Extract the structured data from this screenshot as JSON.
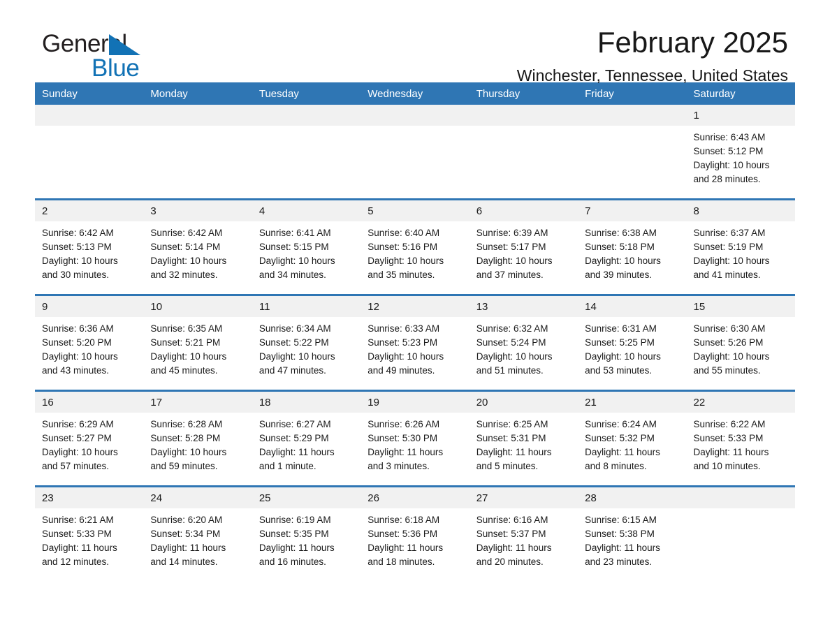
{
  "brand": {
    "word1": "General",
    "word2": "Blue",
    "flag_color": "#1272b5",
    "logo_name": "general-blue-logo"
  },
  "header": {
    "title": "February 2025",
    "subtitle": "Winchester, Tennessee, United States"
  },
  "theme": {
    "header_blue": "#2f76b4",
    "row_divider_blue": "#2f76b4",
    "daynum_band": "#f1f1f1",
    "text": "#1a1a1a"
  },
  "weekday_headers": [
    "Sunday",
    "Monday",
    "Tuesday",
    "Wednesday",
    "Thursday",
    "Friday",
    "Saturday"
  ],
  "labels": {
    "sunrise_prefix": "Sunrise:",
    "sunset_prefix": "Sunset:",
    "daylight_prefix": "Daylight:"
  },
  "weeks": [
    [
      {
        "day": "",
        "blank": true
      },
      {
        "day": "",
        "blank": true
      },
      {
        "day": "",
        "blank": true
      },
      {
        "day": "",
        "blank": true
      },
      {
        "day": "",
        "blank": true
      },
      {
        "day": "",
        "blank": true
      },
      {
        "day": "1",
        "sunrise": "Sunrise: 6:43 AM",
        "sunset": "Sunset: 5:12 PM",
        "daylight1": "Daylight: 10 hours",
        "daylight2": "and 28 minutes."
      }
    ],
    [
      {
        "day": "2",
        "sunrise": "Sunrise: 6:42 AM",
        "sunset": "Sunset: 5:13 PM",
        "daylight1": "Daylight: 10 hours",
        "daylight2": "and 30 minutes."
      },
      {
        "day": "3",
        "sunrise": "Sunrise: 6:42 AM",
        "sunset": "Sunset: 5:14 PM",
        "daylight1": "Daylight: 10 hours",
        "daylight2": "and 32 minutes."
      },
      {
        "day": "4",
        "sunrise": "Sunrise: 6:41 AM",
        "sunset": "Sunset: 5:15 PM",
        "daylight1": "Daylight: 10 hours",
        "daylight2": "and 34 minutes."
      },
      {
        "day": "5",
        "sunrise": "Sunrise: 6:40 AM",
        "sunset": "Sunset: 5:16 PM",
        "daylight1": "Daylight: 10 hours",
        "daylight2": "and 35 minutes."
      },
      {
        "day": "6",
        "sunrise": "Sunrise: 6:39 AM",
        "sunset": "Sunset: 5:17 PM",
        "daylight1": "Daylight: 10 hours",
        "daylight2": "and 37 minutes."
      },
      {
        "day": "7",
        "sunrise": "Sunrise: 6:38 AM",
        "sunset": "Sunset: 5:18 PM",
        "daylight1": "Daylight: 10 hours",
        "daylight2": "and 39 minutes."
      },
      {
        "day": "8",
        "sunrise": "Sunrise: 6:37 AM",
        "sunset": "Sunset: 5:19 PM",
        "daylight1": "Daylight: 10 hours",
        "daylight2": "and 41 minutes."
      }
    ],
    [
      {
        "day": "9",
        "sunrise": "Sunrise: 6:36 AM",
        "sunset": "Sunset: 5:20 PM",
        "daylight1": "Daylight: 10 hours",
        "daylight2": "and 43 minutes."
      },
      {
        "day": "10",
        "sunrise": "Sunrise: 6:35 AM",
        "sunset": "Sunset: 5:21 PM",
        "daylight1": "Daylight: 10 hours",
        "daylight2": "and 45 minutes."
      },
      {
        "day": "11",
        "sunrise": "Sunrise: 6:34 AM",
        "sunset": "Sunset: 5:22 PM",
        "daylight1": "Daylight: 10 hours",
        "daylight2": "and 47 minutes."
      },
      {
        "day": "12",
        "sunrise": "Sunrise: 6:33 AM",
        "sunset": "Sunset: 5:23 PM",
        "daylight1": "Daylight: 10 hours",
        "daylight2": "and 49 minutes."
      },
      {
        "day": "13",
        "sunrise": "Sunrise: 6:32 AM",
        "sunset": "Sunset: 5:24 PM",
        "daylight1": "Daylight: 10 hours",
        "daylight2": "and 51 minutes."
      },
      {
        "day": "14",
        "sunrise": "Sunrise: 6:31 AM",
        "sunset": "Sunset: 5:25 PM",
        "daylight1": "Daylight: 10 hours",
        "daylight2": "and 53 minutes."
      },
      {
        "day": "15",
        "sunrise": "Sunrise: 6:30 AM",
        "sunset": "Sunset: 5:26 PM",
        "daylight1": "Daylight: 10 hours",
        "daylight2": "and 55 minutes."
      }
    ],
    [
      {
        "day": "16",
        "sunrise": "Sunrise: 6:29 AM",
        "sunset": "Sunset: 5:27 PM",
        "daylight1": "Daylight: 10 hours",
        "daylight2": "and 57 minutes."
      },
      {
        "day": "17",
        "sunrise": "Sunrise: 6:28 AM",
        "sunset": "Sunset: 5:28 PM",
        "daylight1": "Daylight: 10 hours",
        "daylight2": "and 59 minutes."
      },
      {
        "day": "18",
        "sunrise": "Sunrise: 6:27 AM",
        "sunset": "Sunset: 5:29 PM",
        "daylight1": "Daylight: 11 hours",
        "daylight2": "and 1 minute."
      },
      {
        "day": "19",
        "sunrise": "Sunrise: 6:26 AM",
        "sunset": "Sunset: 5:30 PM",
        "daylight1": "Daylight: 11 hours",
        "daylight2": "and 3 minutes."
      },
      {
        "day": "20",
        "sunrise": "Sunrise: 6:25 AM",
        "sunset": "Sunset: 5:31 PM",
        "daylight1": "Daylight: 11 hours",
        "daylight2": "and 5 minutes."
      },
      {
        "day": "21",
        "sunrise": "Sunrise: 6:24 AM",
        "sunset": "Sunset: 5:32 PM",
        "daylight1": "Daylight: 11 hours",
        "daylight2": "and 8 minutes."
      },
      {
        "day": "22",
        "sunrise": "Sunrise: 6:22 AM",
        "sunset": "Sunset: 5:33 PM",
        "daylight1": "Daylight: 11 hours",
        "daylight2": "and 10 minutes."
      }
    ],
    [
      {
        "day": "23",
        "sunrise": "Sunrise: 6:21 AM",
        "sunset": "Sunset: 5:33 PM",
        "daylight1": "Daylight: 11 hours",
        "daylight2": "and 12 minutes."
      },
      {
        "day": "24",
        "sunrise": "Sunrise: 6:20 AM",
        "sunset": "Sunset: 5:34 PM",
        "daylight1": "Daylight: 11 hours",
        "daylight2": "and 14 minutes."
      },
      {
        "day": "25",
        "sunrise": "Sunrise: 6:19 AM",
        "sunset": "Sunset: 5:35 PM",
        "daylight1": "Daylight: 11 hours",
        "daylight2": "and 16 minutes."
      },
      {
        "day": "26",
        "sunrise": "Sunrise: 6:18 AM",
        "sunset": "Sunset: 5:36 PM",
        "daylight1": "Daylight: 11 hours",
        "daylight2": "and 18 minutes."
      },
      {
        "day": "27",
        "sunrise": "Sunrise: 6:16 AM",
        "sunset": "Sunset: 5:37 PM",
        "daylight1": "Daylight: 11 hours",
        "daylight2": "and 20 minutes."
      },
      {
        "day": "28",
        "sunrise": "Sunrise: 6:15 AM",
        "sunset": "Sunset: 5:38 PM",
        "daylight1": "Daylight: 11 hours",
        "daylight2": "and 23 minutes."
      },
      {
        "day": "",
        "blank": true
      }
    ]
  ]
}
